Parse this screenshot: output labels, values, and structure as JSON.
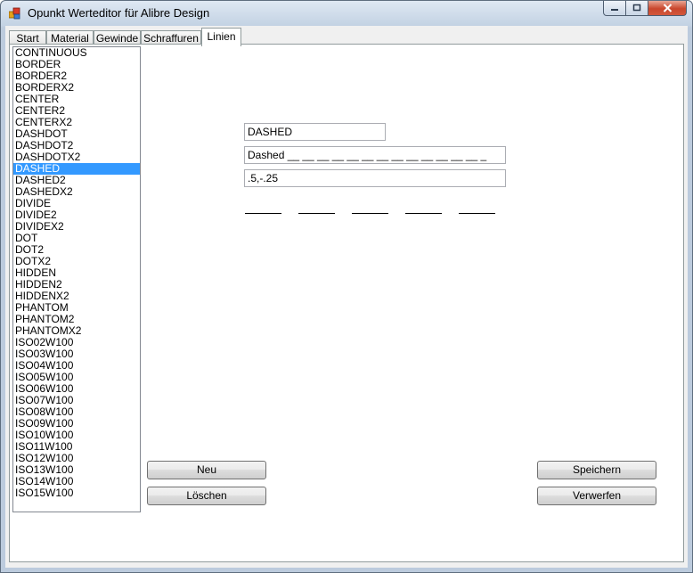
{
  "window": {
    "title": "Opunkt Werteditor für Alibre Design"
  },
  "tabs": [
    {
      "label": "Start"
    },
    {
      "label": "Material"
    },
    {
      "label": "Gewinde"
    },
    {
      "label": "Schraffuren"
    },
    {
      "label": "Linien",
      "active": true
    }
  ],
  "linetypes": {
    "items": [
      "CONTINUOUS",
      "BORDER",
      "BORDER2",
      "BORDERX2",
      "CENTER",
      "CENTER2",
      "CENTERX2",
      "DASHDOT",
      "DASHDOT2",
      "DASHDOTX2",
      "DASHED",
      "DASHED2",
      "DASHEDX2",
      "DIVIDE",
      "DIVIDE2",
      "DIVIDEX2",
      "DOT",
      "DOT2",
      "DOTX2",
      "HIDDEN",
      "HIDDEN2",
      "HIDDENX2",
      "PHANTOM",
      "PHANTOM2",
      "PHANTOMX2",
      "ISO02W100",
      "ISO03W100",
      "ISO04W100",
      "ISO05W100",
      "ISO06W100",
      "ISO07W100",
      "ISO08W100",
      "ISO09W100",
      "ISO10W100",
      "ISO11W100",
      "ISO12W100",
      "ISO13W100",
      "ISO14W100",
      "ISO15W100"
    ],
    "selected": "DASHED"
  },
  "editor": {
    "name_value": "DASHED",
    "description_value": "Dashed __ __ __ __ __ __ __ __ __ __ __ __ __ _",
    "pattern_value": ".5,-.25"
  },
  "buttons": {
    "new_label": "Neu",
    "delete_label": "Löschen",
    "save_label": "Speichern",
    "discard_label": "Verwerfen"
  }
}
